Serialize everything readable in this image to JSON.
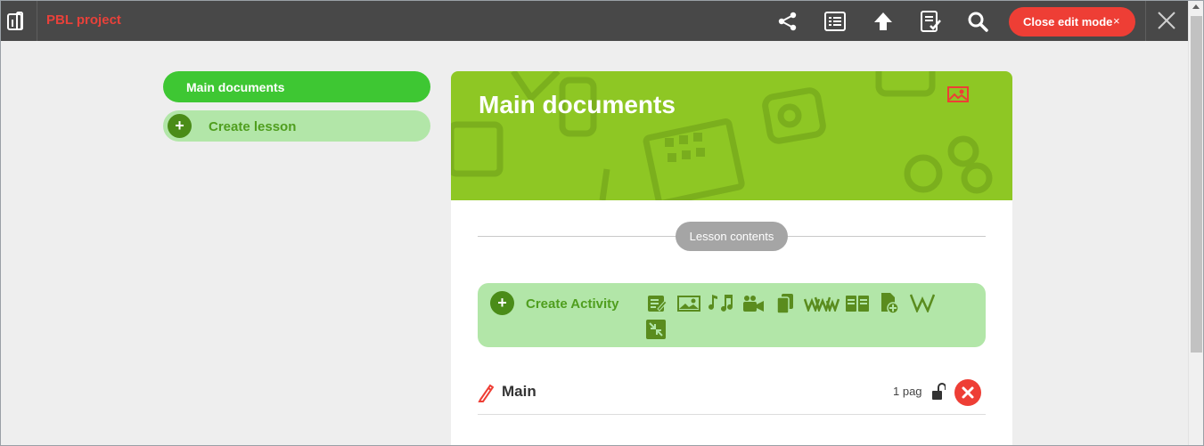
{
  "header": {
    "app_title": "PBL project",
    "close_edit_label": "Close edit mode",
    "close_edit_x": "×",
    "icons": [
      "book-icon",
      "share-icon",
      "list-icon",
      "upload-icon",
      "checklist-icon",
      "search-icon",
      "close-icon"
    ]
  },
  "sidebar": {
    "main_documents": "Main documents",
    "create_lesson": "Create lesson",
    "plus": "+"
  },
  "main": {
    "banner_title": "Main documents",
    "lesson_contents": "Lesson contents",
    "create_activity": "Create Activity",
    "plus": "+",
    "activity_icons": [
      "text-edit-icon",
      "image-icon",
      "music-icon",
      "video-camera-icon",
      "copy-icon",
      "web-link-icon",
      "book-open-icon",
      "document-add-icon",
      "wikipedia-icon",
      "embed-icon"
    ],
    "document": {
      "title": "Main",
      "pages": "1 pag"
    }
  },
  "colors": {
    "accent_red": "#ee3e35",
    "brand_green": "#3ec733",
    "light_green": "#b2e6a8",
    "banner_green": "#8ec724",
    "topbar": "#484848"
  }
}
